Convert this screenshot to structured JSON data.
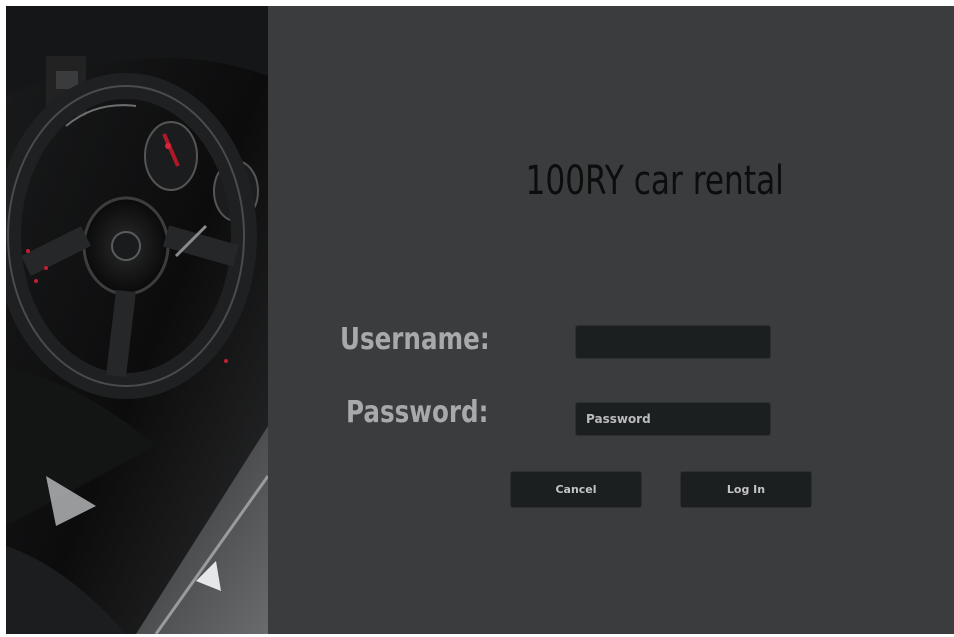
{
  "app": {
    "title": "100RY car rental"
  },
  "login_form": {
    "username_label": "Username:",
    "username_value": "",
    "password_label": "Password:",
    "password_placeholder": "Password",
    "cancel_label": "Cancel",
    "login_label": "Log In"
  },
  "colors": {
    "panel_background": "#3a3c3d",
    "field_background": "#1c1f20",
    "label_text": "#a7a9aa",
    "title_text": "#0c0d0d"
  }
}
